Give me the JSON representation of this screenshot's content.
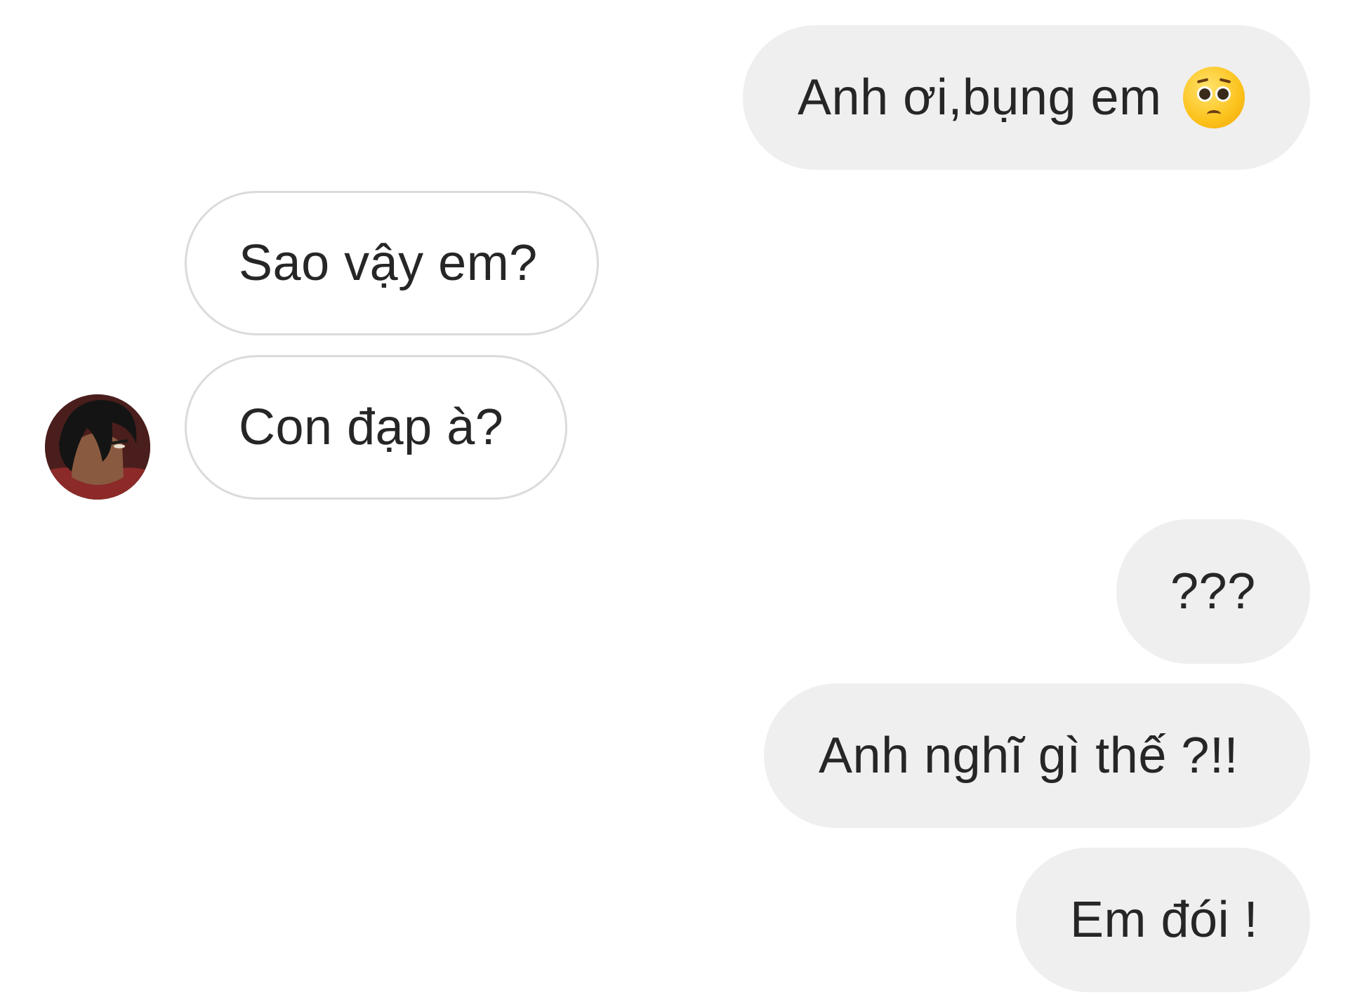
{
  "messages": [
    {
      "id": "m1",
      "side": "outgoing",
      "text": "Anh ơi,bụng em",
      "emoji": "pleading-face-emoji"
    },
    {
      "id": "m2",
      "side": "incoming",
      "text": "Sao vậy em?"
    },
    {
      "id": "m3",
      "side": "incoming",
      "text": "Con đạp à?"
    },
    {
      "id": "m4",
      "side": "outgoing",
      "text": "???"
    },
    {
      "id": "m5",
      "side": "outgoing",
      "text": "Anh nghĩ gì thế ?!!"
    },
    {
      "id": "m6",
      "side": "outgoing",
      "text": "Em đói !"
    }
  ],
  "colors": {
    "outgoing_bubble": "#efefef",
    "incoming_border": "#dbdbdb",
    "text": "#262626",
    "background": "#ffffff"
  },
  "avatar": {
    "icon": "user-avatar-anime-portrait"
  }
}
